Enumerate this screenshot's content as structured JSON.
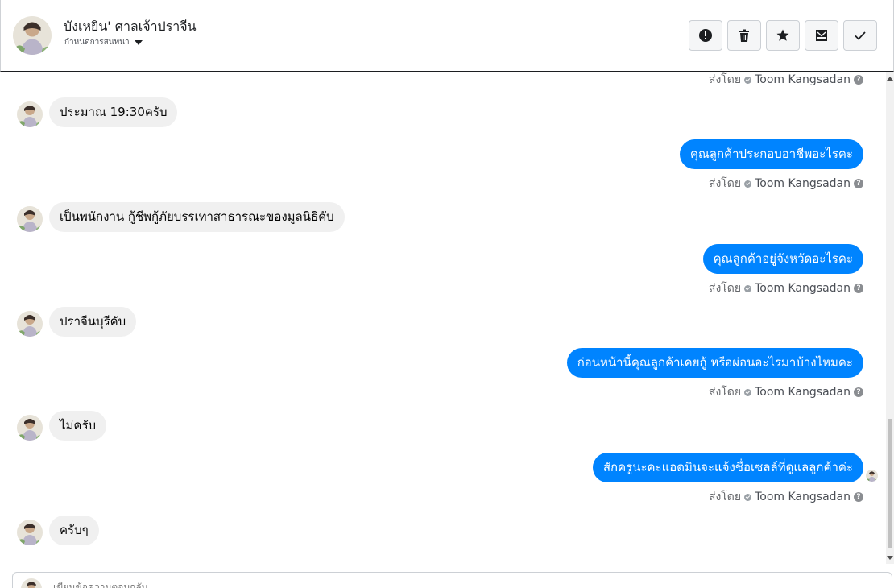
{
  "header": {
    "contact_name": "บังเหยิน' ศาลเจ้าปราจีน",
    "subtitle": "กำหนดการสนทนา",
    "buttons": [
      {
        "name": "mark-spam-button",
        "icon": "alert-icon"
      },
      {
        "name": "delete-button",
        "icon": "trash-icon"
      },
      {
        "name": "star-button",
        "icon": "star-icon"
      },
      {
        "name": "mark-unread-button",
        "icon": "envelope-icon"
      },
      {
        "name": "mark-done-button",
        "icon": "check-icon"
      }
    ]
  },
  "thread": {
    "sent_by_label": "ส่งโดย",
    "agent_name": "Toom Kangsadan",
    "messages": [
      {
        "direction": "in",
        "text": "ประมาณ 19:30ครับ"
      },
      {
        "direction": "out",
        "text": "คุณลูกค้าประกอบอาชีพอะไรคะ"
      },
      {
        "direction": "in",
        "text": "เป็นพนักงาน กู้ชีพกู้ภัยบรรเทาสาธารณะของมูลนิธิคับ"
      },
      {
        "direction": "out",
        "text": "คุณลูกค้าอยู่จังหวัดอะไรคะ"
      },
      {
        "direction": "in",
        "text": "ปราจีนบุรีคับ"
      },
      {
        "direction": "out",
        "text": "ก่อนหน้านี้คุณลูกค้าเคยกู้ หรือผ่อนอะไรมาบ้างไหมคะ"
      },
      {
        "direction": "in",
        "text": "ไม่ครับ"
      },
      {
        "direction": "out",
        "text": "สักครู่นะคะแอดมินจะแจ้งชื่อเซลล์ที่ดูแลลูกค้าค่ะ"
      },
      {
        "direction": "in",
        "text": "ครับๆ"
      }
    ]
  },
  "composer": {
    "placeholder": "เขียนข้อความตอบกลับ..."
  },
  "colors": {
    "outgoing_bubble": "#0084ff",
    "incoming_bubble": "#f0f0f0",
    "meta_text": "#65676b"
  }
}
